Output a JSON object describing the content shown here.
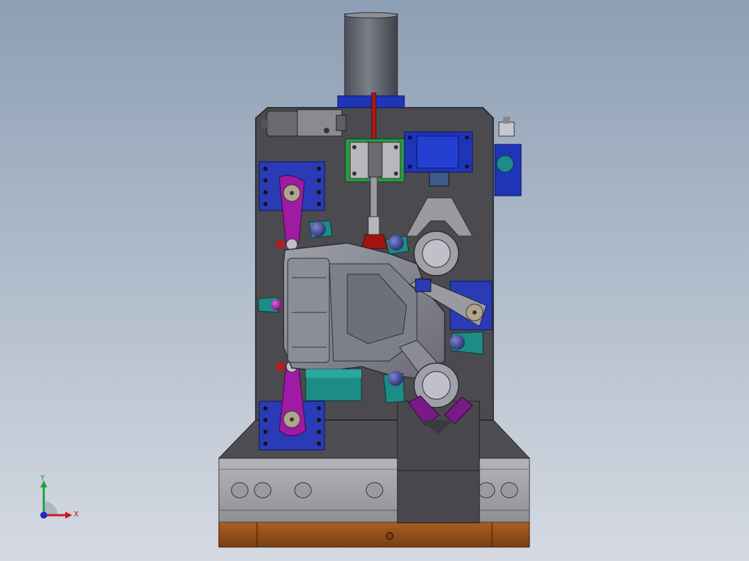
{
  "viewport": {
    "background_top": "#8d9fb5",
    "background_bottom": "#d5dae2"
  },
  "colors": {
    "plate": "#4a4a4f",
    "plate_edge": "#222226",
    "rail": "#a8a8ac",
    "base": "#a0561e",
    "motor": "#666a72",
    "blue": "#1f35b8",
    "teal": "#1b8d86",
    "magenta": "#a11aa3",
    "green": "#22a04a",
    "red": "#c01818",
    "part": "#8a8b94"
  },
  "triad": {
    "x_label": "X",
    "y_label": "Y",
    "x_color": "#c8191e",
    "y_color": "#18a33a",
    "z_color": "#1a2cc0"
  }
}
